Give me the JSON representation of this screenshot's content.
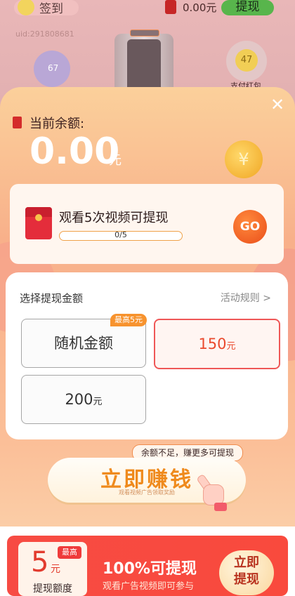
{
  "background": {
    "sign_in_label": "签到",
    "balance_top": "0.00元",
    "withdraw_top_label": "提现",
    "uid": "uid:291808681",
    "lightning_value": "67",
    "coin_value": "47",
    "alipay_label": "支付红包"
  },
  "modal": {
    "current_balance_label": "当前余额:",
    "amount": "0.00",
    "amount_unit": "元",
    "yen_symbol": "¥",
    "task": {
      "title": "观看5次视频可提现",
      "progress_text": "0/5",
      "progress_value": 0,
      "go_label": "GO"
    },
    "select": {
      "heading": "选择提现金额",
      "rules_label": "活动规则 >",
      "options": [
        {
          "label": "随机金额",
          "badge": "最高5元",
          "unit": ""
        },
        {
          "label": "150",
          "unit": "元",
          "selected": true
        },
        {
          "label": "200",
          "unit": "元"
        }
      ]
    },
    "tip": "余额不足，赚更多可提现",
    "earn_button": "立即赚钱",
    "earn_sub": "观看视频广告领取奖励"
  },
  "banner": {
    "tag": "最高",
    "quota_value": "5",
    "quota_unit": "元",
    "quota_label": "提现额度",
    "title": "100%可提现",
    "subtitle": "观看广告视频即可参与",
    "button_label": "立即\n提现"
  },
  "colors": {
    "accent_orange": "#f7932e",
    "selected_red": "#ef5757",
    "banner_red": "#f74b43",
    "go_orange": "#ea4e1a"
  }
}
